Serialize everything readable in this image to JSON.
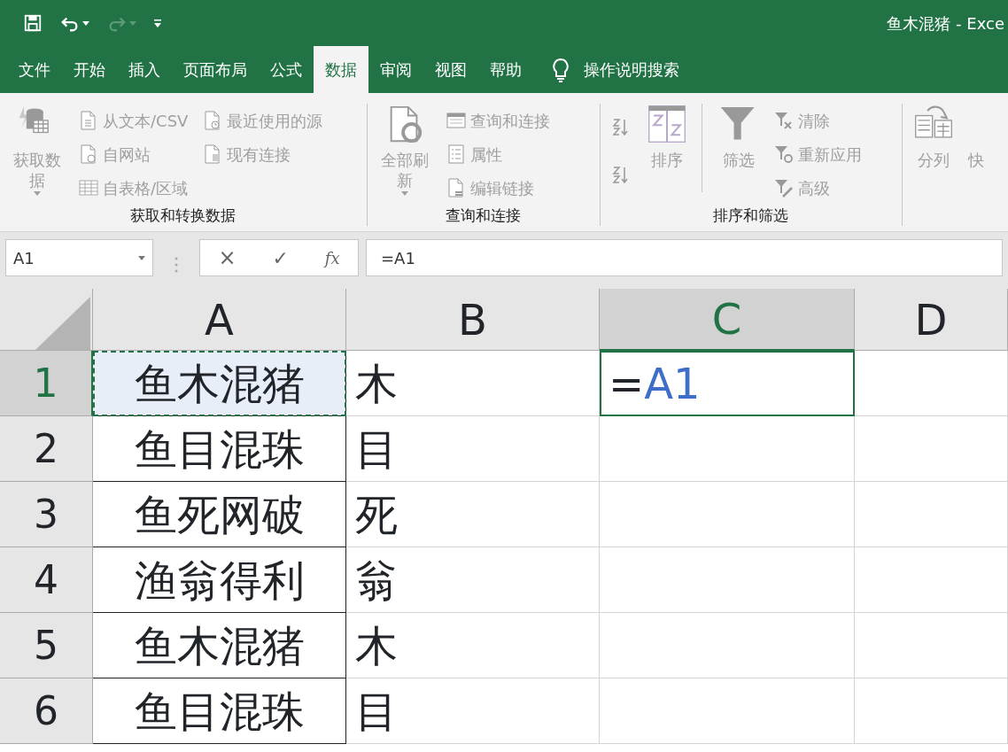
{
  "window": {
    "title": "鱼木混猪  -  Exce"
  },
  "quick_access": [
    {
      "disabled": false,
      "has_menu": false
    },
    {
      "disabled": false,
      "has_menu": true
    },
    {
      "disabled": true,
      "has_menu": true
    },
    {
      "disabled": false,
      "has_menu": false
    }
  ],
  "tabs": [
    {
      "label": "文件",
      "selected": false
    },
    {
      "label": "开始",
      "selected": false
    },
    {
      "label": "插入",
      "selected": false
    },
    {
      "label": "页面布局",
      "selected": false
    },
    {
      "label": "公式",
      "selected": false
    },
    {
      "label": "数据",
      "selected": true
    },
    {
      "label": "审阅",
      "selected": false
    },
    {
      "label": "视图",
      "selected": false
    },
    {
      "label": "帮助",
      "selected": false
    }
  ],
  "tell_me": {
    "label": "操作说明搜索"
  },
  "ribbon": {
    "groups": [
      {
        "label": "获取和转换数据",
        "columns": [
          [
            {
              "kind": "large",
              "label": "获取数据",
              "has_menu": true,
              "disabled": true
            }
          ],
          [
            {
              "kind": "small",
              "label": "从文本/CSV",
              "disabled": true
            },
            {
              "kind": "small",
              "label": "自网站",
              "disabled": true
            },
            {
              "kind": "small",
              "label": "自表格/区域",
              "disabled": true
            }
          ],
          [
            {
              "kind": "small",
              "label": "最近使用的源",
              "disabled": true
            },
            {
              "kind": "small",
              "label": "现有连接",
              "disabled": true
            }
          ]
        ]
      },
      {
        "label": "查询和连接",
        "columns": [
          [
            {
              "kind": "large",
              "label": "全部刷新",
              "has_menu": true,
              "disabled": true
            }
          ],
          [
            {
              "kind": "small",
              "label": "查询和连接",
              "disabled": true
            },
            {
              "kind": "small",
              "label": "属性",
              "disabled": true
            },
            {
              "kind": "small",
              "label": "编辑链接",
              "disabled": true
            }
          ]
        ]
      },
      {
        "label": "排序和筛选",
        "columns": [
          [
            {
              "kind": "icon",
              "disabled": true
            },
            {
              "kind": "icon",
              "disabled": true
            }
          ],
          [
            {
              "kind": "large",
              "label": "排序",
              "has_menu": false,
              "disabled": true
            }
          ],
          [
            {
              "kind": "large",
              "label": "筛选",
              "has_menu": false,
              "disabled": true
            }
          ],
          [
            {
              "kind": "small",
              "label": "清除",
              "disabled": true
            },
            {
              "kind": "small",
              "label": "重新应用",
              "disabled": true
            },
            {
              "kind": "small",
              "label": "高级",
              "disabled": true
            }
          ]
        ]
      },
      {
        "columns": [
          [
            {
              "kind": "large",
              "label": "分列",
              "has_menu": false,
              "disabled": true
            }
          ],
          [
            {
              "kind": "large",
              "label": "快",
              "has_menu": false,
              "disabled": true
            }
          ]
        ]
      }
    ]
  },
  "formula_bar": {
    "name_box": "A1",
    "cancel": "×",
    "enter": "✓",
    "function_label": "fx",
    "formula": "=A1"
  },
  "sheet": {
    "columns": [
      {
        "label": "A",
        "selected": false
      },
      {
        "label": "B",
        "selected": false
      },
      {
        "label": "C",
        "selected": true
      },
      {
        "label": "D",
        "selected": false
      }
    ],
    "rows": [
      {
        "label": "1",
        "selected": true,
        "cells": [
          {
            "value": "鱼木混猪",
            "copied": true
          },
          {
            "value": "木"
          },
          {
            "editing": true,
            "formula_prefix": "=",
            "reference": "A1"
          },
          {}
        ]
      },
      {
        "label": "2",
        "selected": false,
        "cells": [
          {
            "value": "鱼目混珠"
          },
          {
            "value": "目"
          },
          {},
          {}
        ]
      },
      {
        "label": "3",
        "selected": false,
        "cells": [
          {
            "value": "鱼死网破"
          },
          {
            "value": "死"
          },
          {},
          {}
        ]
      },
      {
        "label": "4",
        "selected": false,
        "cells": [
          {
            "value": "渔翁得利"
          },
          {
            "value": "翁"
          },
          {},
          {}
        ]
      },
      {
        "label": "5",
        "selected": false,
        "cells": [
          {
            "value": "鱼木混猪"
          },
          {
            "value": "木"
          },
          {},
          {}
        ]
      },
      {
        "label": "6",
        "selected": false,
        "cells": [
          {
            "value": "鱼目混珠"
          },
          {
            "value": "目"
          },
          {},
          {}
        ]
      }
    ]
  }
}
